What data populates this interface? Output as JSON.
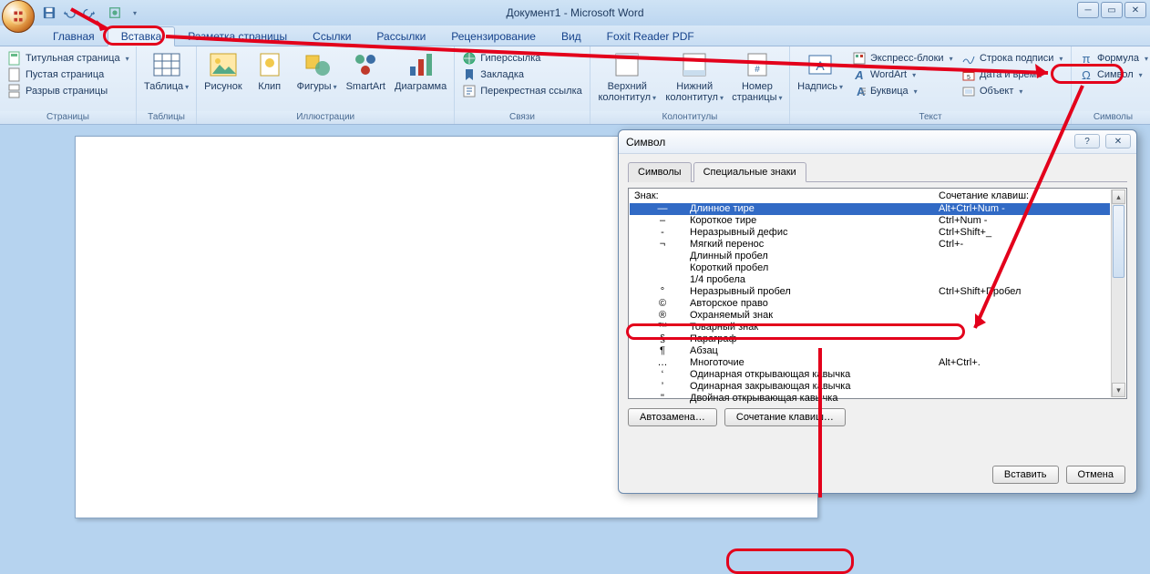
{
  "app": {
    "title": "Документ1 - Microsoft Word"
  },
  "tabs": {
    "home": "Главная",
    "insert": "Вставка",
    "layout": "Разметка страницы",
    "refs": "Ссылки",
    "mail": "Рассылки",
    "review": "Рецензирование",
    "view": "Вид",
    "foxit": "Foxit Reader PDF"
  },
  "ribbon": {
    "pages": {
      "label": "Страницы",
      "cover": "Титульная страница",
      "blank": "Пустая страница",
      "break": "Разрыв страницы"
    },
    "tables": {
      "label": "Таблицы",
      "table": "Таблица"
    },
    "illus": {
      "label": "Иллюстрации",
      "picture": "Рисунок",
      "clip": "Клип",
      "shapes": "Фигуры",
      "smartart": "SmartArt",
      "chart": "Диаграмма"
    },
    "links": {
      "label": "Связи",
      "hyper": "Гиперссылка",
      "bookmark": "Закладка",
      "crossref": "Перекрестная ссылка"
    },
    "headers": {
      "label": "Колонтитулы",
      "header": "Верхний колонтитул",
      "footer": "Нижний колонтитул",
      "pagenum": "Номер страницы"
    },
    "text": {
      "label": "Текст",
      "textbox": "Надпись",
      "quick": "Экспресс-блоки",
      "wordart": "WordArt",
      "dropcap": "Буквица",
      "sigline": "Строка подписи",
      "datetime": "Дата и время",
      "object": "Объект"
    },
    "symbols": {
      "label": "Символы",
      "equation": "Формула",
      "symbol": "Символ"
    }
  },
  "dialog": {
    "title": "Символ",
    "tab_symbols": "Символы",
    "tab_special": "Специальные знаки",
    "col_char": "Знак:",
    "col_shortcut": "Сочетание клавиш:",
    "rows": [
      {
        "g": "—",
        "n": "Длинное тире",
        "k": "Alt+Ctrl+Num -"
      },
      {
        "g": "–",
        "n": "Короткое тире",
        "k": "Ctrl+Num -"
      },
      {
        "g": "-",
        "n": "Неразрывный дефис",
        "k": "Ctrl+Shift+_"
      },
      {
        "g": "¬",
        "n": "Мягкий перенос",
        "k": "Ctrl+-"
      },
      {
        "g": "",
        "n": "Длинный пробел",
        "k": ""
      },
      {
        "g": "",
        "n": "Короткий пробел",
        "k": ""
      },
      {
        "g": "",
        "n": "1/4 пробела",
        "k": ""
      },
      {
        "g": "°",
        "n": "Неразрывный пробел",
        "k": "Ctrl+Shift+Пробел"
      },
      {
        "g": "©",
        "n": "Авторское право",
        "k": ""
      },
      {
        "g": "®",
        "n": "Охраняемый знак",
        "k": ""
      },
      {
        "g": "™",
        "n": "Товарный знак",
        "k": ""
      },
      {
        "g": "§",
        "n": "Параграф",
        "k": ""
      },
      {
        "g": "¶",
        "n": "Абзац",
        "k": ""
      },
      {
        "g": "…",
        "n": "Многоточие",
        "k": "Alt+Ctrl+."
      },
      {
        "g": "‘",
        "n": "Одинарная открывающая кавычка",
        "k": ""
      },
      {
        "g": "’",
        "n": "Одинарная закрывающая кавычка",
        "k": ""
      },
      {
        "g": "\"",
        "n": "Двойная открывающая кавычка",
        "k": ""
      }
    ],
    "btn_autocorrect": "Автозамена…",
    "btn_shortcut": "Сочетание клавиш…",
    "btn_insert": "Вставить",
    "btn_cancel": "Отмена"
  }
}
